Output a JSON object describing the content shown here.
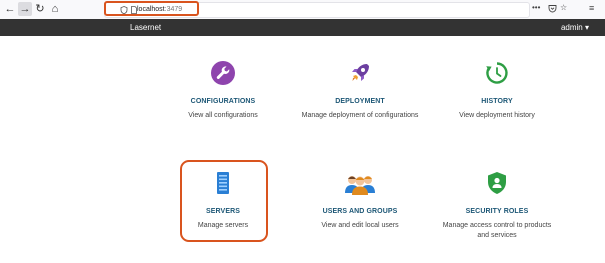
{
  "browser": {
    "url_host": "localhost",
    "url_port": ":3479"
  },
  "app": {
    "brand": "Lasernet",
    "user_menu": "admin ▾"
  },
  "tiles": [
    {
      "title": "CONFIGURATIONS",
      "desc": "View all configurations",
      "icon": "wrench-icon",
      "color": "#8e44ad"
    },
    {
      "title": "DEPLOYMENT",
      "desc": "Manage deployment of configurations",
      "icon": "rocket-icon",
      "color": "#6c3fa0"
    },
    {
      "title": "HISTORY",
      "desc": "View deployment history",
      "icon": "history-icon",
      "color": "#2e9e44"
    },
    {
      "title": "SERVERS",
      "desc": "Manage servers",
      "icon": "server-icon",
      "color": "#2a7fd4"
    },
    {
      "title": "USERS AND GROUPS",
      "desc": "View and edit local users",
      "icon": "users-icon",
      "color": "#e08a1e"
    },
    {
      "title": "SECURITY ROLES",
      "desc": "Manage access control to products and services",
      "icon": "shield-icon",
      "color": "#2e9e44"
    }
  ]
}
